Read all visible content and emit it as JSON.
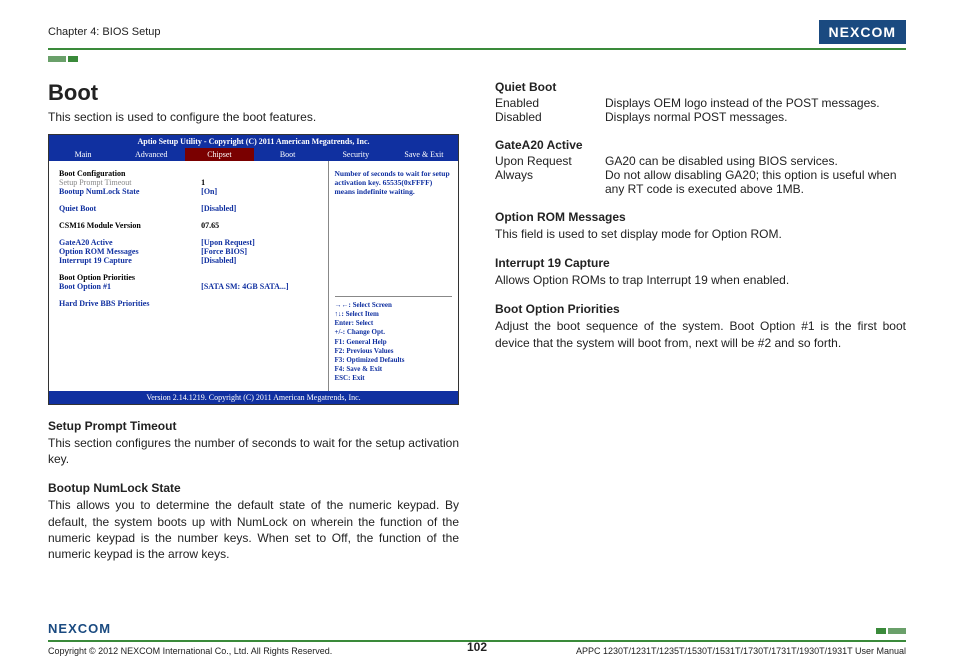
{
  "header": {
    "chapter": "Chapter 4: BIOS Setup",
    "logo": "NEXCOM"
  },
  "left": {
    "title": "Boot",
    "intro": "This section is used to configure the boot features.",
    "bios": {
      "title": "Aptio Setup Utility - Copyright (C) 2011 American Megatrends, Inc.",
      "tabs": [
        "Main",
        "Advanced",
        "Chipset",
        "Boot",
        "Security",
        "Save & Exit"
      ],
      "rows": {
        "boot_config": "Boot Configuration",
        "setup_prompt": "Setup Prompt Timeout",
        "setup_prompt_v": "1",
        "numlock": "Bootup NumLock State",
        "numlock_v": "[On]",
        "quiet": "Quiet Boot",
        "quiet_v": "[Disabled]",
        "csm": "CSM16 Module Version",
        "csm_v": "07.65",
        "ga20": "GateA20 Active",
        "ga20_v": "[Upon Request]",
        "orom": "Option ROM Messages",
        "orom_v": "[Force BIOS]",
        "int19": "Interrupt 19 Capture",
        "int19_v": "[Disabled]",
        "bopri": "Boot Option Priorities",
        "bo1": "Boot Option #1",
        "bo1_v": "[SATA SM: 4GB SATA...]",
        "hdbbs": "Hard Drive BBS Priorities"
      },
      "help_top": "Number of seconds to wait for setup activation key. 65535(0xFFFF) means indefinite waiting.",
      "help_keys": [
        "→←: Select Screen",
        "↑↓: Select Item",
        "Enter: Select",
        "+/-: Change Opt.",
        "F1: General Help",
        "F2: Previous Values",
        "F3: Optimized Defaults",
        "F4: Save & Exit",
        "ESC: Exit"
      ],
      "footer": "Version 2.14.1219. Copyright (C) 2011 American Megatrends, Inc."
    },
    "setup_prompt": {
      "h": "Setup Prompt Timeout",
      "p": "This section configures the number of seconds to wait for the setup activation key."
    },
    "numlock": {
      "h": "Bootup NumLock State",
      "p": "This allows you to determine the default state of the numeric keypad. By default, the system boots up with NumLock on wherein the function of the numeric keypad is the number keys. When set to Off, the function of the numeric keypad is the arrow keys."
    }
  },
  "right": {
    "quiet": {
      "h": "Quiet Boot",
      "en_k": "Enabled",
      "en_v": "Displays OEM logo instead of the POST messages.",
      "di_k": "Disabled",
      "di_v": "Displays normal POST messages."
    },
    "ga20": {
      "h": "GateA20 Active",
      "ur_k": "Upon Request",
      "ur_v": "GA20 can be disabled using BIOS services.",
      "al_k": "Always",
      "al_v": "Do not allow disabling GA20; this option is useful when any RT code is executed above 1MB."
    },
    "orom": {
      "h": "Option ROM Messages",
      "p": "This field is used to set display mode for Option ROM."
    },
    "int19": {
      "h": "Interrupt 19 Capture",
      "p": "Allows Option ROMs to trap Interrupt 19 when enabled."
    },
    "bopri": {
      "h": "Boot Option Priorities",
      "p": "Adjust the boot sequence of the system. Boot Option #1 is the first boot device that the system will boot from, next will be #2 and so forth."
    }
  },
  "footer": {
    "logo": "NEXCOM",
    "copyright": "Copyright © 2012 NEXCOM International Co., Ltd. All Rights Reserved.",
    "page": "102",
    "manual": "APPC 1230T/1231T/1235T/1530T/1531T/1730T/1731T/1930T/1931T User Manual"
  }
}
